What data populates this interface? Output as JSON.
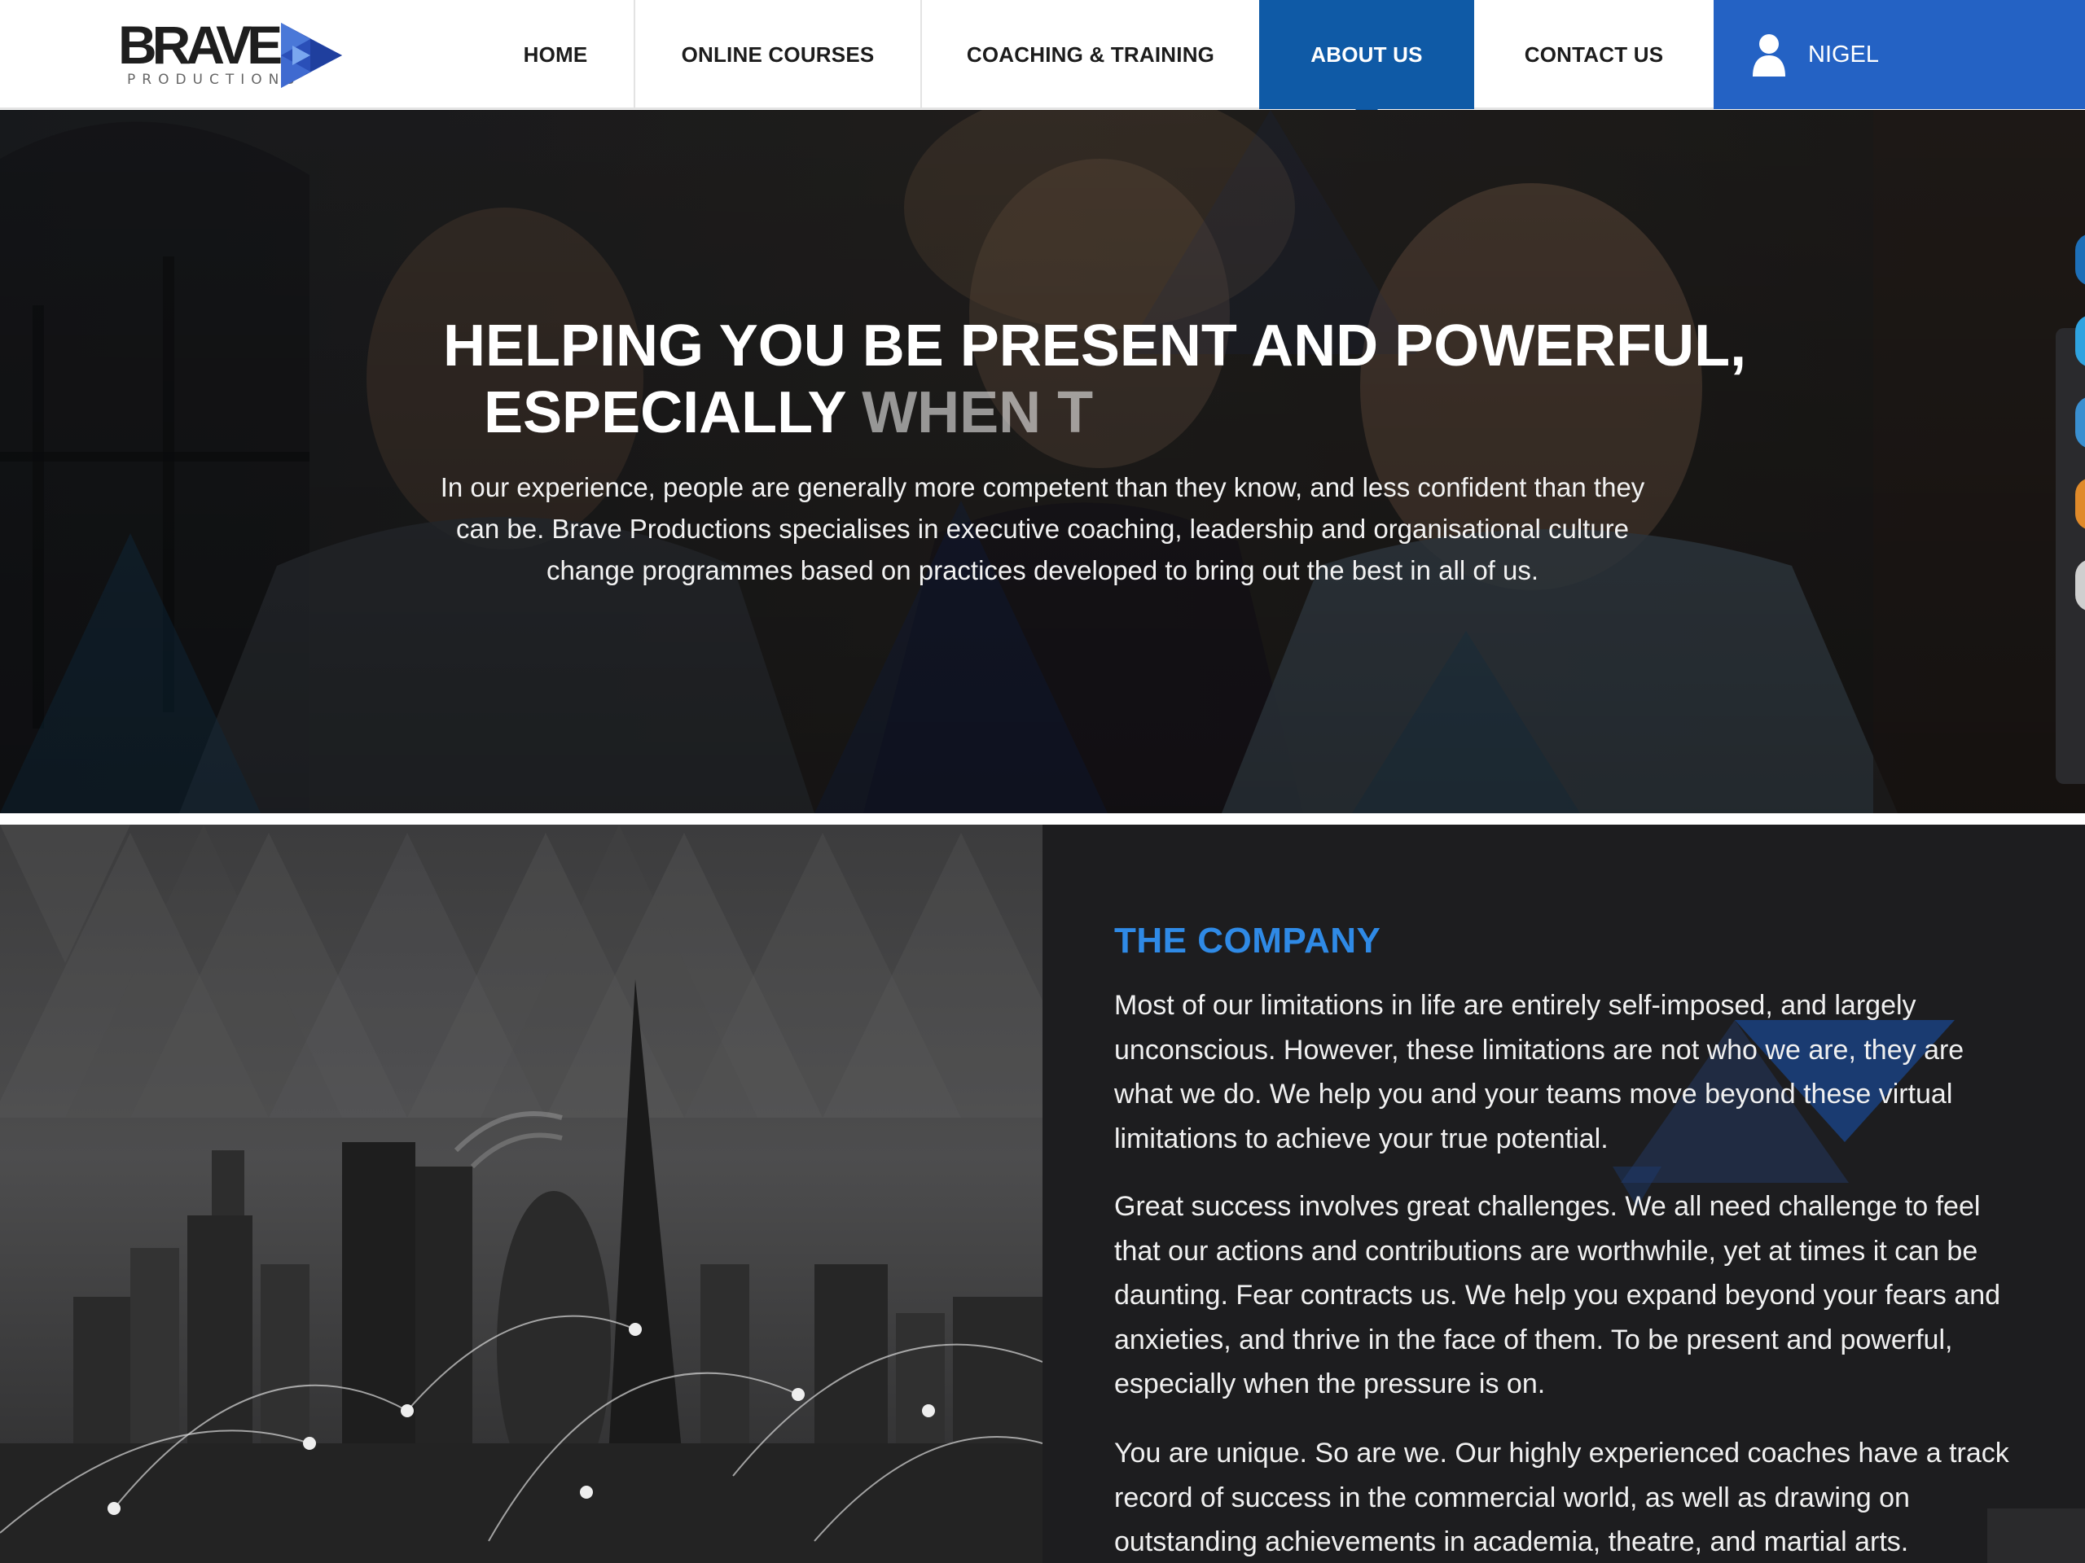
{
  "brand": {
    "name": "BRAVE",
    "tagline": "PRODUCTIONS"
  },
  "nav": {
    "items": [
      {
        "label": "HOME"
      },
      {
        "label": "ONLINE COURSES"
      },
      {
        "label": "COACHING & TRAINING"
      },
      {
        "label": "ABOUT US",
        "active": true
      },
      {
        "label": "CONTACT US"
      }
    ],
    "user": {
      "name": "NIGEL",
      "icon": "user-icon"
    }
  },
  "hero": {
    "title_line1": "HELPING YOU BE PRESENT AND POWERFUL,",
    "title_line2_visible": "ESPECIALLY",
    "title_line2_fading": "WHEN T",
    "body": "In our experience, people are generally more competent than they know, and less confident than they can be. Brave Productions specialises in executive coaching, leadership and organisational culture change programmes based on practices developed to bring out the best in all of us."
  },
  "social": {
    "icons": [
      "facebook-icon",
      "twitter-icon",
      "linkedin-icon",
      "rss-icon",
      "email-icon"
    ],
    "colors": [
      "#1d6fb8",
      "#2fa3e0",
      "#3a8fd0",
      "#e08a2a",
      "#cfcfcf"
    ]
  },
  "company": {
    "heading": "THE COMPANY",
    "paragraphs": [
      "Most of our limitations in life are entirely self-imposed, and largely unconscious. However, these limitations are not who we are, they are what we do. We help you and your teams move beyond these virtual limitations to achieve your true potential.",
      "Great success involves great challenges. We all need challenge to feel that our actions and contributions are worthwhile, yet at times it can be daunting. Fear contracts us. We help you expand beyond your fears and anxieties, and thrive in the face of them. To be present and powerful, especially when the pressure is on.",
      "You are unique. So are we. Our highly experienced coaches have a track record of success in the commercial world, as well as drawing on outstanding achievements in academia, theatre, and martial arts."
    ]
  },
  "colors": {
    "accent": "#0f5aa6",
    "user_bar": "#2462c4",
    "heading_blue": "#2f8ae6"
  }
}
